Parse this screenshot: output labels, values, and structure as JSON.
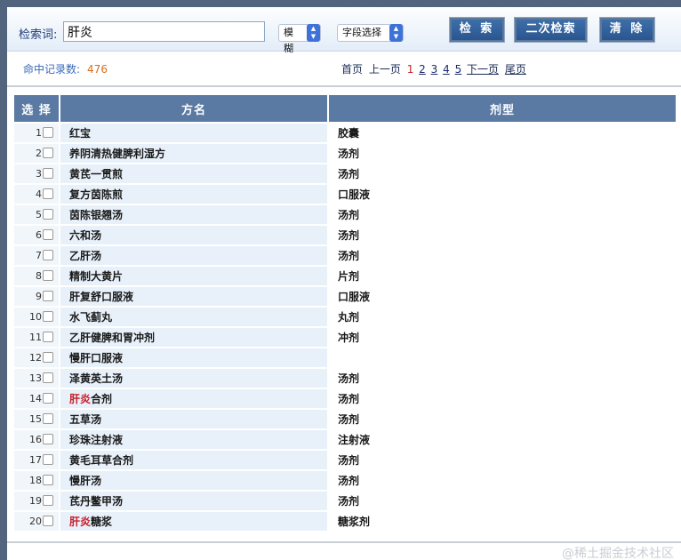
{
  "search": {
    "label": "检索词:",
    "value": "肝炎",
    "mode": "模糊",
    "field": "字段选择",
    "search_button": "检 索",
    "second_search_button": "二次检索",
    "clear_button": "清 除"
  },
  "results": {
    "count_label": "命中记录数:",
    "count": "476"
  },
  "pager": {
    "first": "首页",
    "prev": "上一页",
    "current": "1",
    "pages": [
      "2",
      "3",
      "4",
      "5"
    ],
    "next": "下一页",
    "last": "尾页"
  },
  "table": {
    "headers": {
      "select": "选 择",
      "name": "方名",
      "dosage": "剂型"
    },
    "rows": [
      {
        "index": "1",
        "name": "红宝",
        "name_pre": "",
        "name_hl": "",
        "dosage": "胶囊"
      },
      {
        "index": "2",
        "name": "养阴清热健脾利湿方",
        "name_pre": "",
        "name_hl": "",
        "dosage": "汤剂"
      },
      {
        "index": "3",
        "name": "黄芪一贯煎",
        "name_pre": "",
        "name_hl": "",
        "dosage": "汤剂"
      },
      {
        "index": "4",
        "name": "复方茵陈煎",
        "name_pre": "",
        "name_hl": "",
        "dosage": "口服液"
      },
      {
        "index": "5",
        "name": "茵陈银翘汤",
        "name_pre": "",
        "name_hl": "",
        "dosage": "汤剂"
      },
      {
        "index": "6",
        "name": "六和汤",
        "name_pre": "",
        "name_hl": "",
        "dosage": "汤剂"
      },
      {
        "index": "7",
        "name": "乙肝汤",
        "name_pre": "",
        "name_hl": "",
        "dosage": "汤剂"
      },
      {
        "index": "8",
        "name": "精制大黄片",
        "name_pre": "",
        "name_hl": "",
        "dosage": "片剂"
      },
      {
        "index": "9",
        "name": "肝复舒口服液",
        "name_pre": "",
        "name_hl": "",
        "dosage": "口服液"
      },
      {
        "index": "10",
        "name": "水飞蓟丸",
        "name_pre": "",
        "name_hl": "",
        "dosage": "丸剂"
      },
      {
        "index": "11",
        "name": "乙肝健脾和胃冲剂",
        "name_pre": "",
        "name_hl": "",
        "dosage": "冲剂"
      },
      {
        "index": "12",
        "name": "慢肝口服液",
        "name_pre": "",
        "name_hl": "",
        "dosage": ""
      },
      {
        "index": "13",
        "name": "泽黄英土汤",
        "name_pre": "",
        "name_hl": "",
        "dosage": "汤剂"
      },
      {
        "index": "14",
        "name": "合剂",
        "name_pre": "",
        "name_hl": "肝炎",
        "dosage": "汤剂"
      },
      {
        "index": "15",
        "name": "五草汤",
        "name_pre": "",
        "name_hl": "",
        "dosage": "汤剂"
      },
      {
        "index": "16",
        "name": "珍珠注射液",
        "name_pre": "",
        "name_hl": "",
        "dosage": "注射液"
      },
      {
        "index": "17",
        "name": "黄毛耳草合剂",
        "name_pre": "",
        "name_hl": "",
        "dosage": "汤剂"
      },
      {
        "index": "18",
        "name": "慢肝汤",
        "name_pre": "",
        "name_hl": "",
        "dosage": "汤剂"
      },
      {
        "index": "19",
        "name": "芪丹鳖甲汤",
        "name_pre": "",
        "name_hl": "",
        "dosage": "汤剂"
      },
      {
        "index": "20",
        "name": "糖浆",
        "name_pre": "",
        "name_hl": "肝炎",
        "dosage": "糖浆剂"
      }
    ]
  },
  "watermark": "@稀土掘金技术社区",
  "colors": {
    "header_bg": "#5a79a3",
    "row_bg": "#e8f1fa",
    "highlight": "#c8202a",
    "count": "#d56f1f",
    "button_bg": "#2a5590"
  }
}
